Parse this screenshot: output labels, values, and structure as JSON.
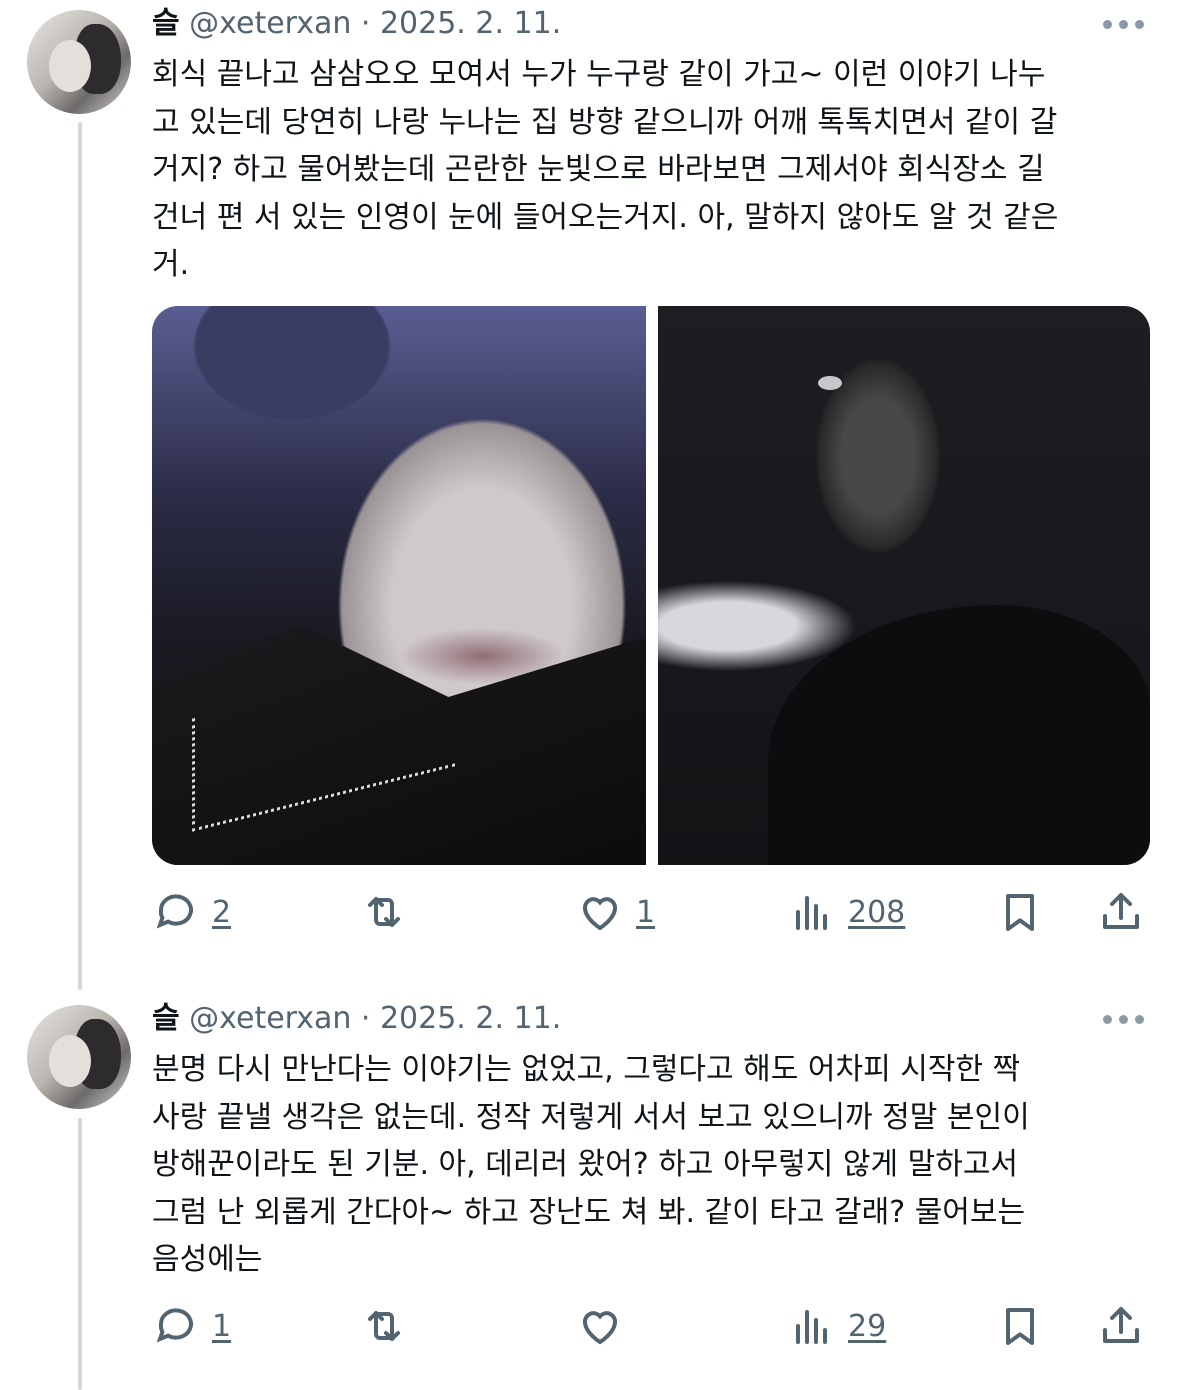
{
  "colors": {
    "text": "#0f1419",
    "muted": "#536471",
    "thread_line": "#cfd9de"
  },
  "tweets": [
    {
      "name": "슬",
      "handle": "@xeterxan",
      "separator": " · ",
      "date": "2025. 2. 11.",
      "lines": [
        "회식 끝나고 삼삼오오 모여서 누가 누구랑 같이 가고~ 이런 이야기 나누",
        "고 있는데 당연히 나랑 누나는 집 방향 같으니까 어깨 톡톡치면서 같이 갈",
        "거지? 하고 물어봤는데 곤란한 눈빛으로 바라보면 그제서야 회식장소 길",
        "건너 편 서 있는 인영이 눈에 들어오는거지. 아, 말하지 않아도 알 것 같은",
        "거."
      ],
      "has_media": true,
      "stats": {
        "replies": "2",
        "retweets": "",
        "likes": "1",
        "views": "208"
      }
    },
    {
      "name": "슬",
      "handle": "@xeterxan",
      "separator": " · ",
      "date": "2025. 2. 11.",
      "lines": [
        "분명 다시 만난다는 이야기는 없었고, 그렇다고 해도 어차피 시작한 짝",
        "사랑 끝낼 생각은 없는데. 정작 저렇게 서서 보고 있으니까 정말 본인이",
        "방해꾼이라도 된 기분. 아, 데리러 왔어? 하고 아무렇지 않게 말하고서",
        "그럼 난 외롭게 간다아~ 하고 장난도 쳐 봐. 같이 타고 갈래? 물어보는",
        "음성에는"
      ],
      "has_media": false,
      "stats": {
        "replies": "1",
        "retweets": "",
        "likes": "",
        "views": "29"
      }
    }
  ],
  "icons": [
    "more-icon",
    "reply-icon",
    "retweet-icon",
    "like-icon",
    "views-icon",
    "bookmark-icon",
    "share-icon"
  ]
}
